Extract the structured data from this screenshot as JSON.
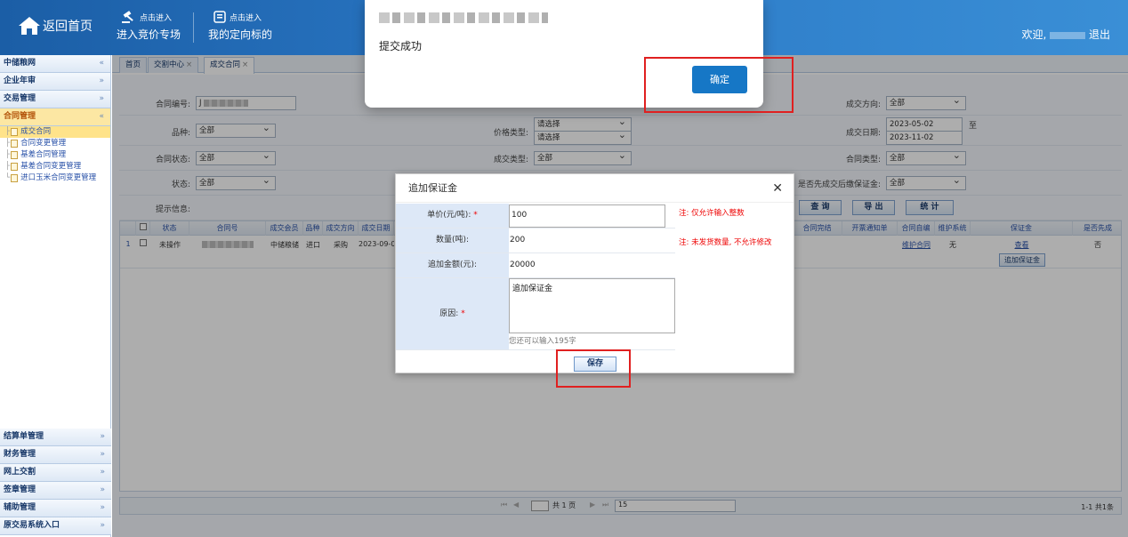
{
  "header": {
    "home_label": "返回首页",
    "bid_top": "点击进入",
    "bid_bottom": "进入竞价专场",
    "directed_top": "点击进入",
    "directed_bottom": "我的定向标的",
    "welcome": "欢迎,",
    "logout": "退出"
  },
  "sidebar": {
    "top": [
      {
        "label": "中储粮网",
        "chev": "«"
      },
      {
        "label": "企业年审",
        "chev": "»"
      },
      {
        "label": "交易管理",
        "chev": "»"
      },
      {
        "label": "合同管理",
        "chev": "«"
      }
    ],
    "sub": [
      {
        "label": "成交合同"
      },
      {
        "label": "合同变更管理"
      },
      {
        "label": "基差合同管理"
      },
      {
        "label": "基差合同变更管理"
      },
      {
        "label": "进口玉米合同变更管理"
      }
    ],
    "bottom": [
      {
        "label": "结算单管理"
      },
      {
        "label": "财务管理"
      },
      {
        "label": "网上交割"
      },
      {
        "label": "签章管理"
      },
      {
        "label": "辅助管理"
      },
      {
        "label": "原交易系统入口"
      }
    ]
  },
  "tabs": {
    "home": "首页",
    "trade_center": "交割中心",
    "contract": "成交合同",
    "close": "×"
  },
  "filters": {
    "contract_no_label": "合同编号:",
    "contract_no_value": "J",
    "direction_label": "成交方向:",
    "direction_value": "全部",
    "variety_label": "品种:",
    "variety_value": "全部",
    "price_type_label": "价格类型:",
    "price_type_value1": "请选择",
    "price_type_value2": "请选择",
    "deal_date_label": "成交日期:",
    "deal_date_from": "2023-05-02",
    "deal_date_to": "2023-11-02",
    "to_label": "至",
    "contract_status_label": "合同状态:",
    "contract_status_value": "全部",
    "deal_type_label": "成交类型:",
    "deal_type_value": "全部",
    "contract_type_label": "合同类型:",
    "contract_type_value": "全部",
    "status_label": "状态:",
    "status_value": "全部",
    "margin_label": "是否先成交后缴保证金:",
    "margin_value": "全部",
    "hint_label": "提示信息:",
    "query_btn": "查 询",
    "export_btn": "导 出",
    "stats_btn": "统 计"
  },
  "grid": {
    "headers": [
      "状态",
      "合同号",
      "成交会员",
      "品种",
      "成交方向",
      "成交日期",
      "合同完结",
      "开票通知单",
      "合同自编",
      "维护系统",
      "保证金",
      "是否先成"
    ],
    "row": {
      "index": "1",
      "status": "未操作",
      "member": "中储粮储",
      "variety": "进口",
      "direction": "采购",
      "date": "2023-09-0",
      "self_edit": "维护合同",
      "maintain": "无",
      "margin_view": "查看",
      "margin_add": "追加保证金",
      "first": "否"
    }
  },
  "pager": {
    "total_pages": "共 1 页",
    "page_size": "15",
    "summary": "1-1 共1条"
  },
  "dialog": {
    "title": "追加保证金",
    "close": "✕",
    "price_label": "单价(元/吨):",
    "price_value": "100",
    "price_note": "注: 仅允许输入整数",
    "qty_label": "数量(吨):",
    "qty_value": "200",
    "qty_note": "注: 未发货数量, 不允许修改",
    "amount_label": "追加金额(元):",
    "amount_value": "20000",
    "reason_label": "原因:",
    "reason_value": "追加保证金",
    "remaining": "您还可以输入195字",
    "required": "*",
    "save": "保存"
  },
  "message": {
    "text": "提交成功",
    "ok": "确定"
  },
  "colors": {
    "header_blue": "#2a77c4",
    "ok_button": "#1677c6",
    "highlight_box": "#e02020"
  }
}
